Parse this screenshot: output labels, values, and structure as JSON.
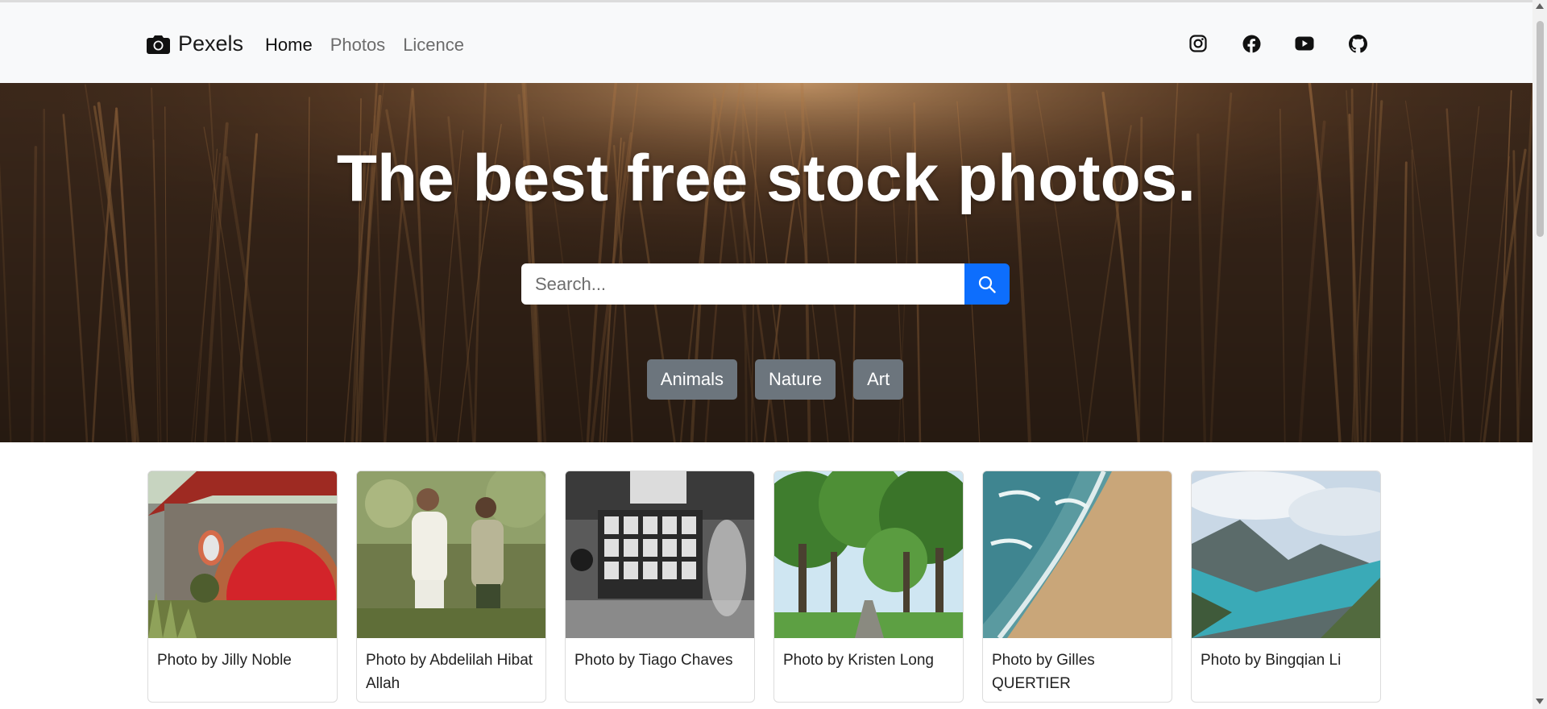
{
  "brand": {
    "name": "Pexels",
    "icon": "camera-icon"
  },
  "nav": {
    "links": [
      {
        "label": "Home",
        "active": true
      },
      {
        "label": "Photos",
        "active": false
      },
      {
        "label": "Licence",
        "active": false
      }
    ],
    "social_icons": [
      "instagram-icon",
      "facebook-icon",
      "youtube-icon",
      "github-icon"
    ]
  },
  "hero": {
    "title": "The best free stock photos.",
    "search": {
      "placeholder": "Search...",
      "value": "",
      "button_icon": "search-icon"
    },
    "tags": [
      "Animals",
      "Nature",
      "Art"
    ]
  },
  "photos": [
    {
      "caption": "Photo by Jilly Noble"
    },
    {
      "caption": "Photo by Abdelilah Hibat Allah"
    },
    {
      "caption": "Photo by Tiago Chaves"
    },
    {
      "caption": "Photo by Kristen Long"
    },
    {
      "caption": "Photo by Gilles QUERTIER"
    },
    {
      "caption": "Photo by Bingqian Li"
    }
  ],
  "colors": {
    "navbar_bg": "#f8f9fa",
    "primary": "#0d6efd",
    "tag_bg": "#6c757d"
  }
}
